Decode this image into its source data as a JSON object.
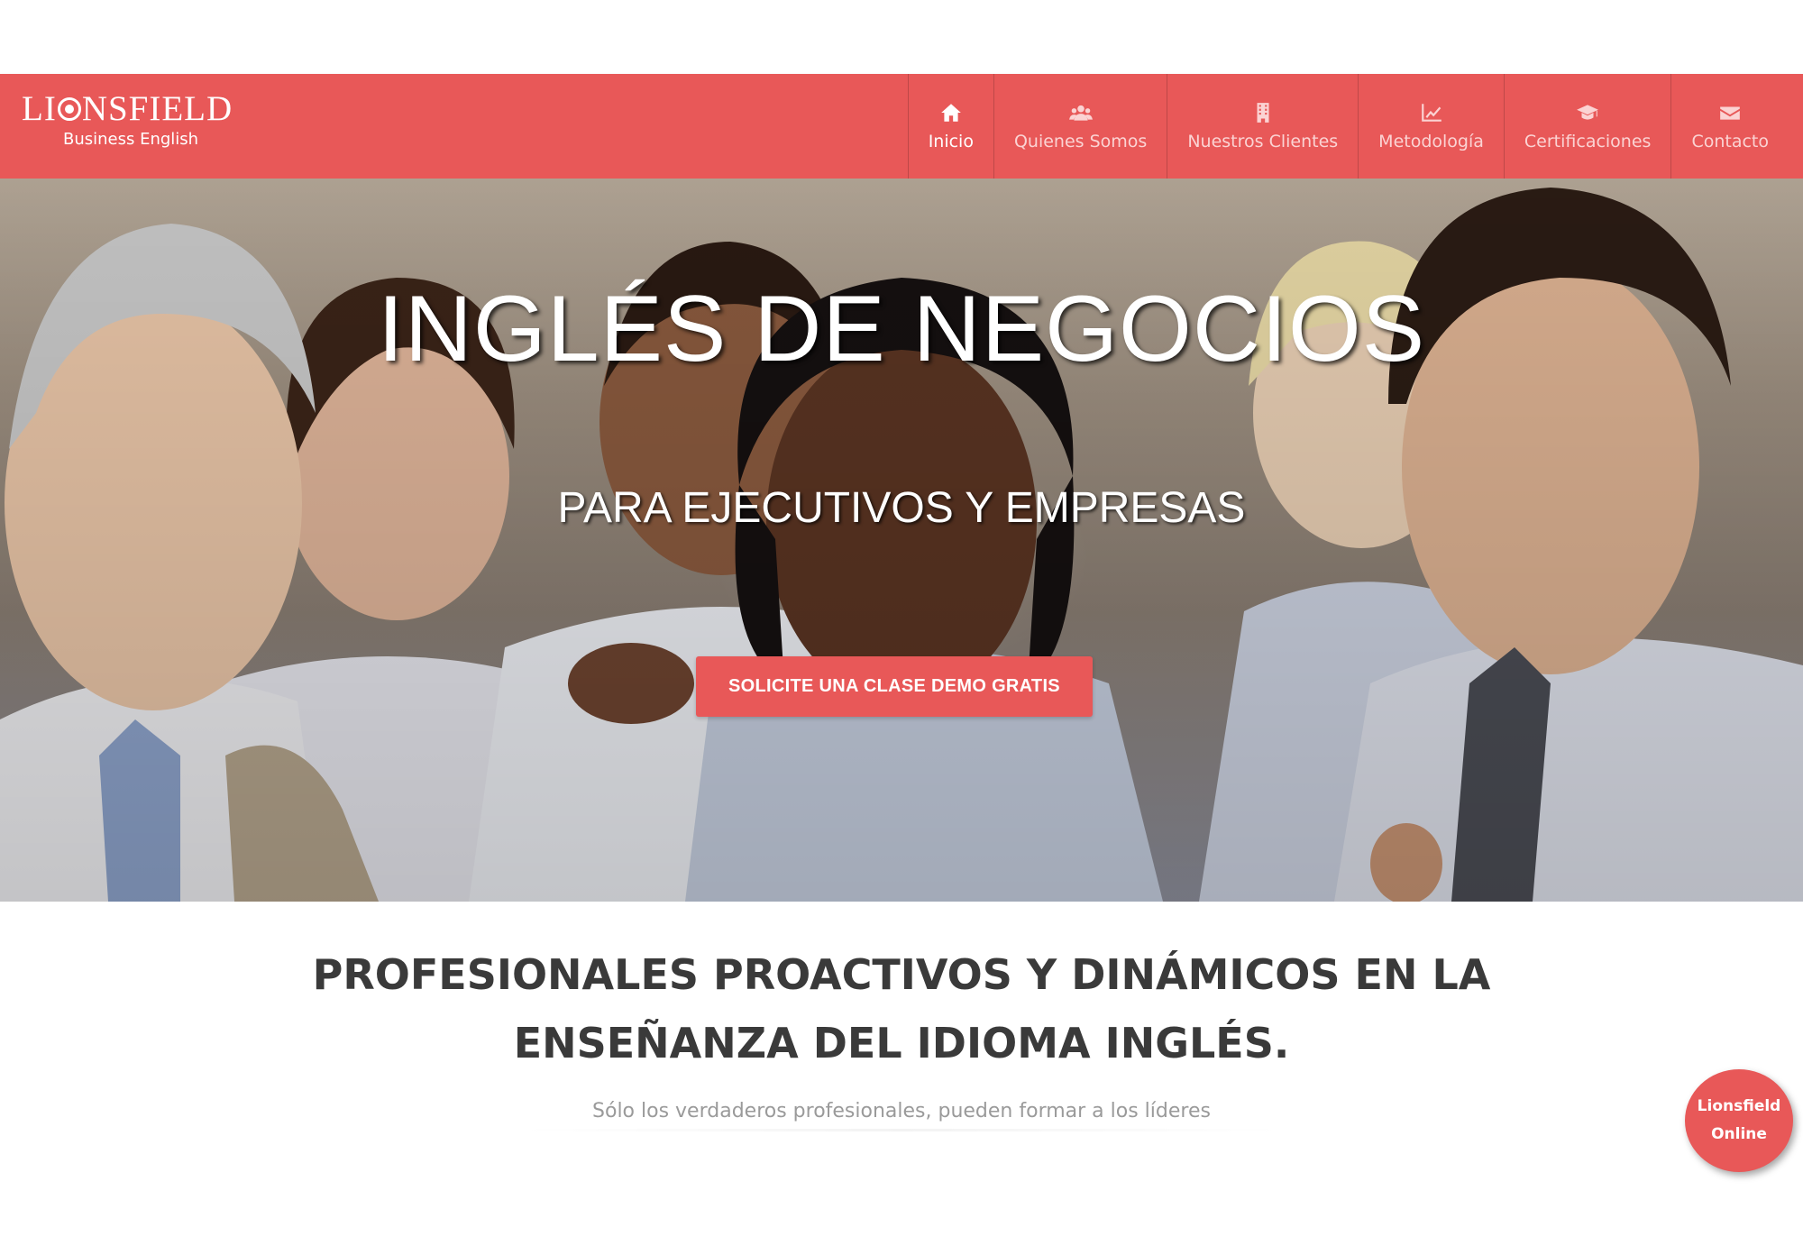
{
  "brand": {
    "logo_pre": "LI",
    "logo_post": "NSFIELD",
    "logo_sub": "Business English",
    "color": "#e85858"
  },
  "nav": {
    "items": [
      {
        "label": "Inicio",
        "icon": "home-icon"
      },
      {
        "label": "Quienes Somos",
        "icon": "users-icon"
      },
      {
        "label": "Nuestros Clientes",
        "icon": "building-icon"
      },
      {
        "label": "Metodología",
        "icon": "chart-icon"
      },
      {
        "label": "Certificaciones",
        "icon": "graduation-cap-icon"
      },
      {
        "label": "Contacto",
        "icon": "envelope-icon"
      }
    ],
    "active": "Inicio"
  },
  "hero": {
    "title": "INGLÉS DE NEGOCIOS",
    "subtitle": "PARA EJECUTIVOS Y EMPRESAS",
    "cta": "SOLICITE UNA CLASE DEMO GRATIS"
  },
  "content": {
    "headline_line1": "PROFESIONALES PROACTIVOS Y DINÁMICOS EN LA",
    "headline_line2": "ENSEÑANZA DEL IDIOMA INGLÉS.",
    "tagline": "Sólo los verdaderos profesionales, pueden formar a los líderes"
  },
  "floating": {
    "line1": "Lionsfield",
    "line2": "Online"
  }
}
